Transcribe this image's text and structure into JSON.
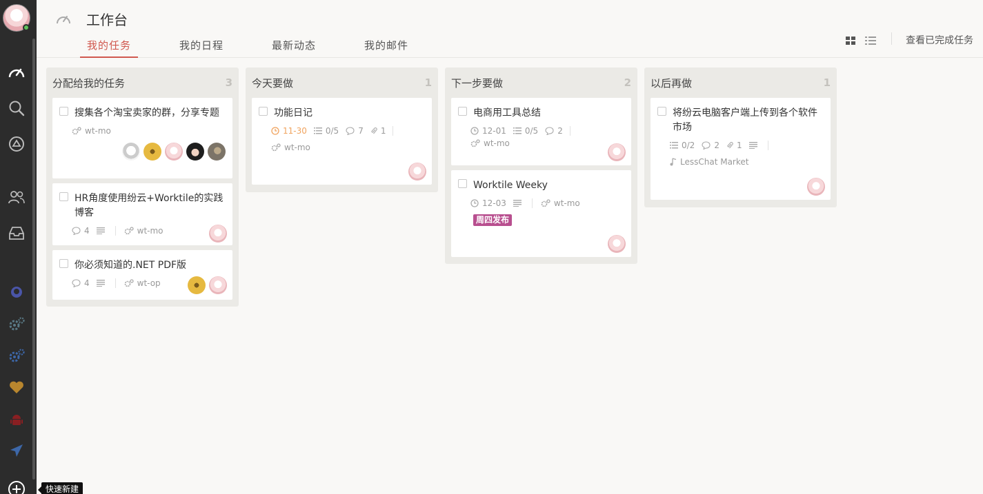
{
  "header": {
    "title": "工作台",
    "tabs": [
      "我的任务",
      "我的日程",
      "最新动态",
      "我的邮件"
    ],
    "done_link": "查看已完成任务"
  },
  "sidebar": {
    "quick_new_tooltip": "快速新建",
    "icons": [
      "dashboard-icon",
      "search-icon",
      "bell-icon",
      "team-icon",
      "inbox-icon",
      "github-icon",
      "gears-icon",
      "gears-blue-icon",
      "heart-icon",
      "android-icon",
      "plane-icon",
      "plus-circle-icon"
    ]
  },
  "columns": [
    {
      "title": "分配给我的任务",
      "count": "3",
      "cards": [
        {
          "title": "搜集各个淘宝卖家的群，分享专题",
          "project": "wt-mo"
        },
        {
          "title": "HR角度使用纷云+Worktile的实践博客",
          "comments": "4",
          "project": "wt-mo"
        },
        {
          "title": "你必须知道的.NET PDF版",
          "comments": "4",
          "project": "wt-op"
        }
      ]
    },
    {
      "title": "今天要做",
      "count": "1",
      "cards": [
        {
          "title": "功能日记",
          "due": "11-30",
          "checklist": "0/5",
          "comments": "7",
          "attachments": "1",
          "project": "wt-mo"
        }
      ]
    },
    {
      "title": "下一步要做",
      "count": "2",
      "cards": [
        {
          "title": "电商用工具总结",
          "due": "12-01",
          "checklist": "0/5",
          "comments": "2",
          "project": "wt-mo"
        },
        {
          "title": "Worktile Weeky",
          "due": "12-03",
          "project": "wt-mo",
          "tag": "周四发布"
        }
      ]
    },
    {
      "title": "以后再做",
      "count": "1",
      "cards": [
        {
          "title": "将纷云电脑客户端上传到各个软件市场",
          "checklist": "0/2",
          "comments": "2",
          "attachments": "1",
          "project": "LessChat Market"
        }
      ]
    }
  ],
  "colors": {
    "accent": "#d0584e",
    "due": "#f0a35e",
    "tag": "#b84f8f",
    "sidebar": "#2c2c2c"
  }
}
